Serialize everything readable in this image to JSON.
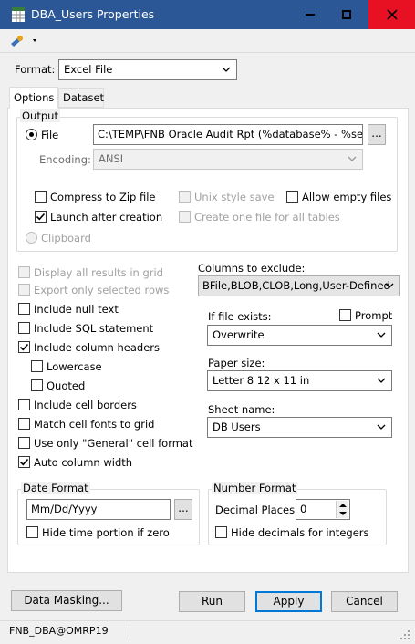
{
  "window": {
    "title": "DBA_Users Properties"
  },
  "format": {
    "label": "Format:",
    "value": "Excel File"
  },
  "tabs": [
    {
      "label": "Options"
    },
    {
      "label": "Dataset"
    }
  ],
  "output": {
    "group_label": "Output",
    "file_label": "File",
    "file_path": "C:\\TEMP\\FNB Oracle Audit Rpt (%database% - %server",
    "browse_label": "...",
    "encoding_label": "Encoding:",
    "encoding_value": "ANSI",
    "compress_zip": "Compress to Zip file",
    "unix_style": "Unix style save",
    "allow_empty": "Allow empty files",
    "launch_after": "Launch after creation",
    "one_file": "Create one file for all tables",
    "clipboard": "Clipboard"
  },
  "options": {
    "display_all": "Display all results in grid",
    "export_selected": "Export only selected rows",
    "include_null": "Include null text",
    "include_sql": "Include SQL statement",
    "include_headers": "Include column headers",
    "lowercase": "Lowercase",
    "quoted": "Quoted",
    "cell_borders": "Include cell borders",
    "match_fonts": "Match cell fonts to grid",
    "general_format": "Use only \"General\" cell format",
    "auto_width": "Auto column width"
  },
  "right": {
    "exclude_label": "Columns to exclude:",
    "exclude_value": "BFile,BLOB,CLOB,Long,User-Defined",
    "if_exists_label": "If file exists:",
    "prompt_label": "Prompt",
    "if_exists_value": "Overwrite",
    "paper_label": "Paper size:",
    "paper_value": "Letter 8 12 x 11 in",
    "sheet_label": "Sheet name:",
    "sheet_value": "DB Users"
  },
  "date": {
    "group_label": "Date Format",
    "value": "Mm/Dd/Yyyy",
    "browse_label": "...",
    "hide_time": "Hide time portion if zero"
  },
  "number": {
    "group_label": "Number Format",
    "decimal_label": "Decimal Places:",
    "decimal_value": "0",
    "hide_decimals": "Hide decimals for integers"
  },
  "buttons": {
    "masking": "Data Masking...",
    "run": "Run",
    "apply": "Apply",
    "cancel": "Cancel"
  },
  "status": {
    "connection": "FNB_DBA@OMRP19"
  },
  "colors": {
    "titlebar": "#2b5797",
    "close": "#e81123",
    "accent": "#0078d7"
  }
}
